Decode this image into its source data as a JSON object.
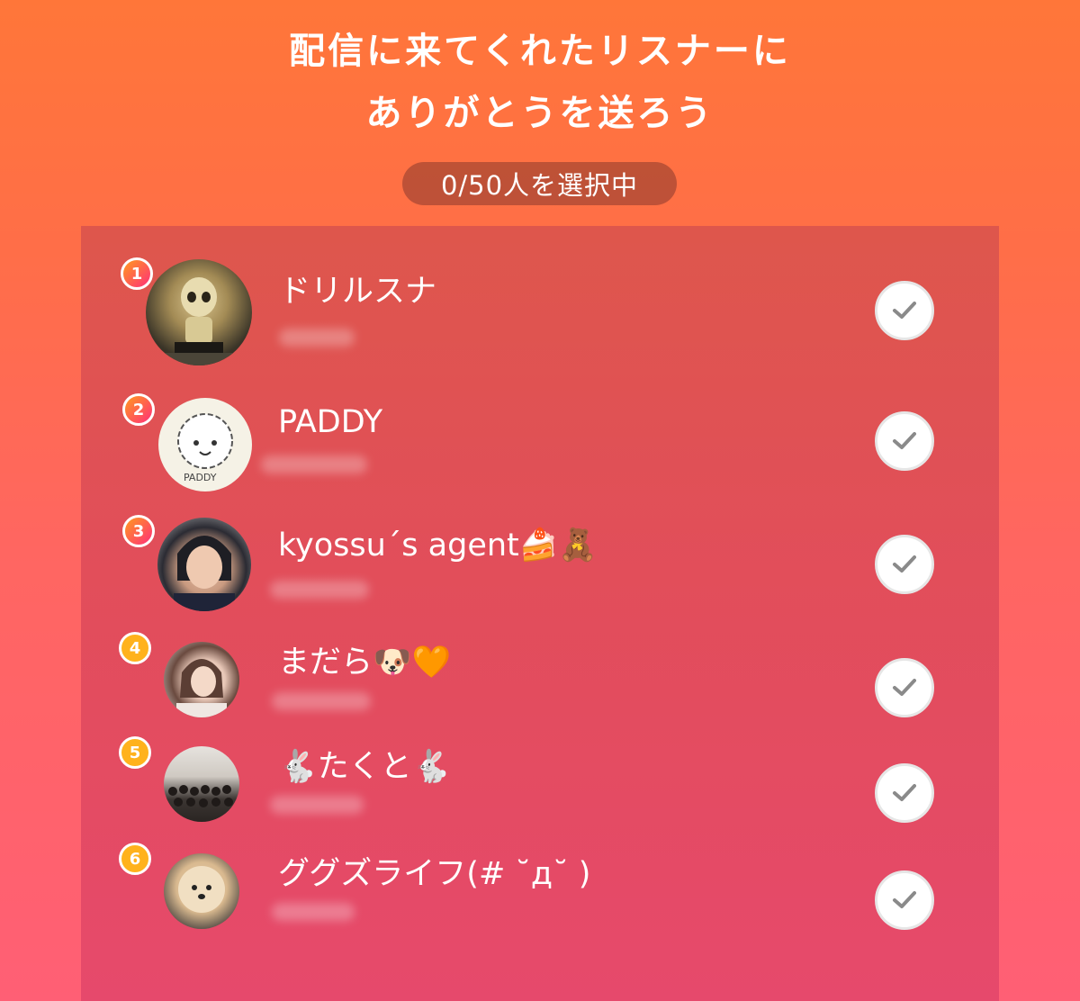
{
  "header": {
    "title_line1": "配信に来てくれたリスナーに",
    "title_line2": "ありがとうを送ろう",
    "selection_counter": "0/50人を選択中"
  },
  "listeners": [
    {
      "rank": "1",
      "name": "ドリルスナ",
      "badge_color": "#ff4d66"
    },
    {
      "rank": "2",
      "name": "PADDY",
      "badge_color": "#ff4d66"
    },
    {
      "rank": "3",
      "name": "kyossu´s agent🍰🧸",
      "badge_color": "#ff4d66"
    },
    {
      "rank": "4",
      "name": "まだら🐶🧡",
      "badge_color": "#ffb21c"
    },
    {
      "rank": "5",
      "name": "🐇たくと🐇",
      "badge_color": "#ffb21c"
    },
    {
      "rank": "6",
      "name": "ググズライフ(# ˘д˘ )",
      "badge_color": "#ffb21c"
    }
  ]
}
